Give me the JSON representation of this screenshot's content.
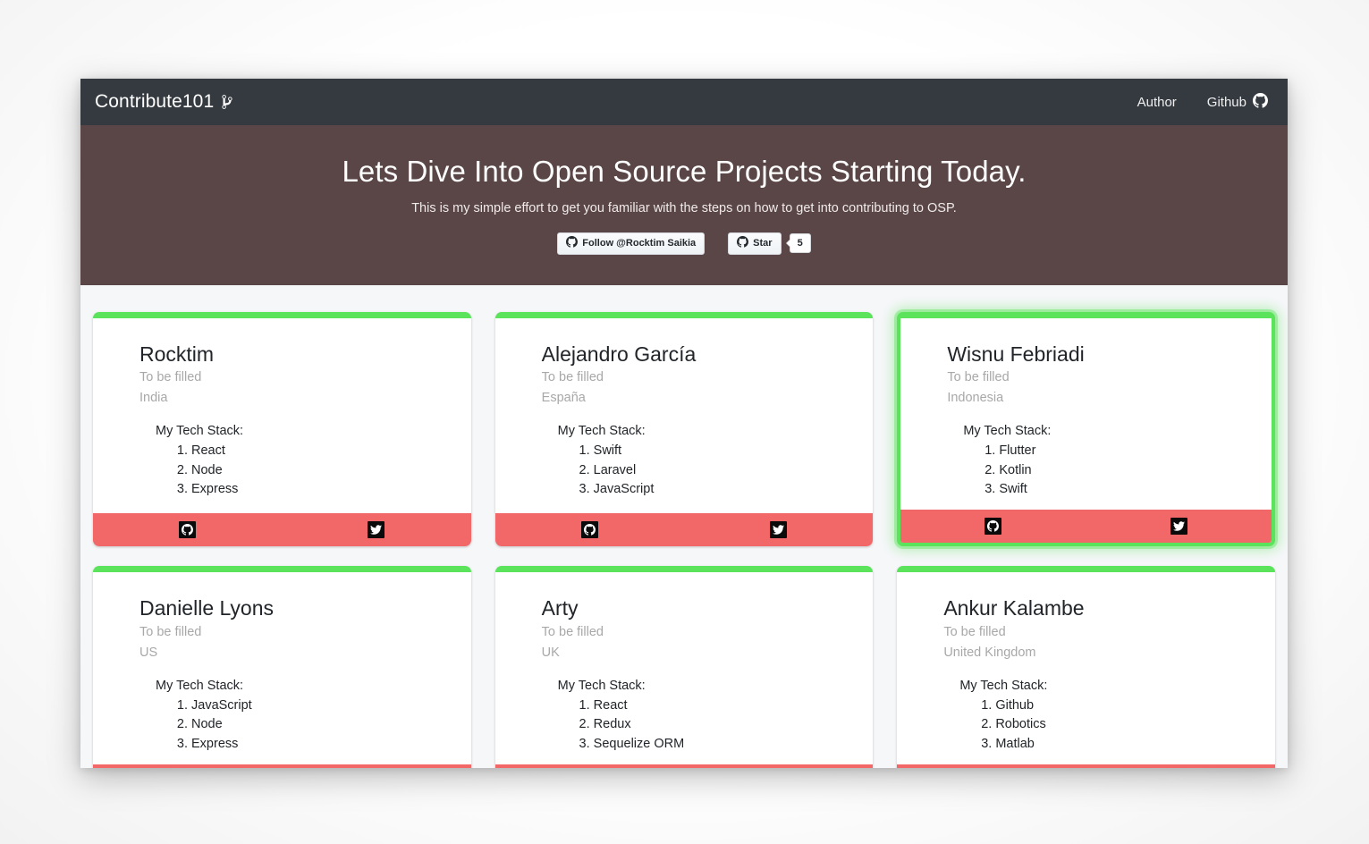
{
  "navbar": {
    "brand": "Contribute101",
    "brand_icon": "git-branch-icon",
    "links": [
      {
        "label": "Author",
        "icon": null
      },
      {
        "label": "Github",
        "icon": "github-icon"
      }
    ]
  },
  "hero": {
    "title": "Lets Dive Into Open Source Projects Starting Today.",
    "subtitle": "This is my simple effort to get you familiar with the steps on how to get into contributing to OSP.",
    "follow_button": {
      "label": "Follow @Rocktim Saikia",
      "icon": "github-icon"
    },
    "star_button": {
      "label": "Star",
      "icon": "github-icon",
      "count": "5"
    }
  },
  "colors": {
    "navbar_bg": "#343a40",
    "hero_bg": "#5a4646",
    "card_accent": "#5ce35c",
    "card_footer": "#f26767",
    "muted_text": "#a8a8a8",
    "page_bg": "#f6f7f9"
  },
  "cards": {
    "stack_label": "My Tech Stack:",
    "placeholder_bio": "To be filled",
    "github_icon": "github-icon",
    "twitter_icon": "twitter-icon",
    "items": [
      {
        "name": "Rocktim",
        "bio": "To be filled",
        "country": "India",
        "stack_label": "My Tech Stack:",
        "stack": [
          "React",
          "Node",
          "Express"
        ],
        "active": false
      },
      {
        "name": "Alejandro García",
        "bio": "To be filled",
        "country": "España",
        "stack_label": "My Tech Stack:",
        "stack": [
          "Swift",
          "Laravel",
          "JavaScript"
        ],
        "active": false
      },
      {
        "name": "Wisnu Febriadi",
        "bio": "To be filled",
        "country": "Indonesia",
        "stack_label": "My Tech Stack:",
        "stack": [
          "Flutter",
          "Kotlin",
          "Swift"
        ],
        "active": true
      },
      {
        "name": "Danielle Lyons",
        "bio": "To be filled",
        "country": "US",
        "stack_label": "My Tech Stack:",
        "stack": [
          "JavaScript",
          "Node",
          "Express"
        ],
        "active": false
      },
      {
        "name": "Arty",
        "bio": "To be filled",
        "country": "UK",
        "stack_label": "My Tech Stack:",
        "stack": [
          "React",
          "Redux",
          "Sequelize ORM"
        ],
        "active": false
      },
      {
        "name": "Ankur Kalambe",
        "bio": "To be filled",
        "country": "United Kingdom",
        "stack_label": "My Tech Stack:",
        "stack": [
          "Github",
          "Robotics",
          "Matlab"
        ],
        "active": false
      }
    ]
  }
}
